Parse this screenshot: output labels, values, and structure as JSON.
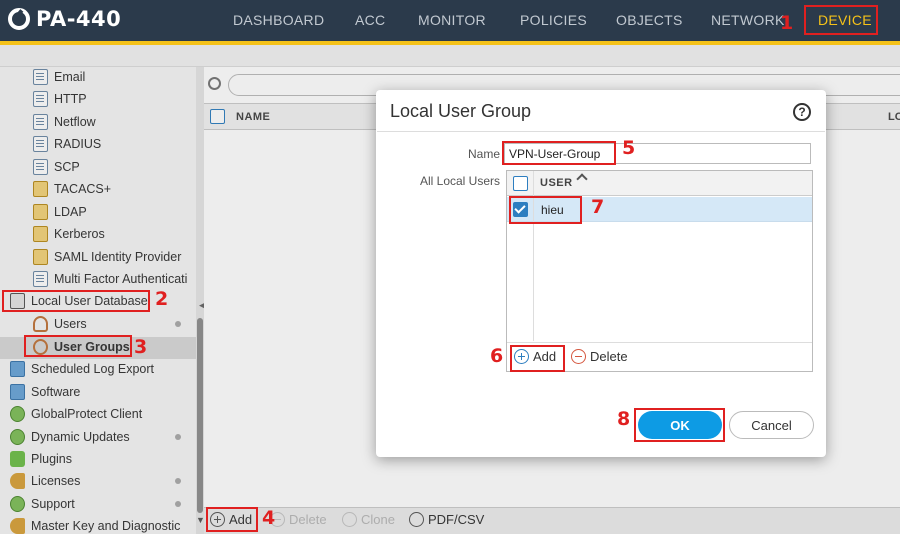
{
  "app": {
    "logo": "PA-440"
  },
  "nav": [
    {
      "label": "DASHBOARD"
    },
    {
      "label": "ACC"
    },
    {
      "label": "MONITOR"
    },
    {
      "label": "POLICIES"
    },
    {
      "label": "OBJECTS"
    },
    {
      "label": "NETWORK"
    },
    {
      "label": "DEVICE"
    }
  ],
  "sidebar": {
    "items": [
      {
        "label": "Email",
        "icon": "document-icon"
      },
      {
        "label": "HTTP",
        "icon": "document-icon"
      },
      {
        "label": "Netflow",
        "icon": "document-icon"
      },
      {
        "label": "RADIUS",
        "icon": "document-icon"
      },
      {
        "label": "SCP",
        "icon": "document-icon"
      },
      {
        "label": "TACACS+",
        "icon": "lock-icon"
      },
      {
        "label": "LDAP",
        "icon": "lock-icon"
      },
      {
        "label": "Kerberos",
        "icon": "lock-icon"
      },
      {
        "label": "SAML Identity Provider",
        "icon": "lock-icon"
      },
      {
        "label": "Multi Factor Authenticati",
        "icon": "document-icon"
      },
      {
        "label": "Local User Database",
        "icon": "database-icon"
      },
      {
        "label": "Users",
        "icon": "user-icon"
      },
      {
        "label": "User Groups",
        "icon": "users-icon"
      },
      {
        "label": "Scheduled Log Export",
        "icon": "export-icon"
      },
      {
        "label": "Software",
        "icon": "software-icon"
      },
      {
        "label": "GlobalProtect Client",
        "icon": "globe-icon"
      },
      {
        "label": "Dynamic Updates",
        "icon": "update-icon"
      },
      {
        "label": "Plugins",
        "icon": "puzzle-icon"
      },
      {
        "label": "Licenses",
        "icon": "key-icon"
      },
      {
        "label": "Support",
        "icon": "support-icon"
      },
      {
        "label": "Master Key and Diagnostic",
        "icon": "key-icon"
      }
    ]
  },
  "grid": {
    "columns": [
      "NAME",
      "LO"
    ]
  },
  "toolbar": {
    "add": "Add",
    "delete": "Delete",
    "clone": "Clone",
    "pdf_csv": "PDF/CSV"
  },
  "dialog": {
    "title": "Local User Group",
    "help": "?",
    "name_label": "Name",
    "name_value": "VPN-User-Group",
    "all_users_label": "All Local Users",
    "users_column": "USER",
    "users": [
      "hieu"
    ],
    "add": "Add",
    "delete": "Delete",
    "ok": "OK",
    "cancel": "Cancel"
  },
  "annotations": [
    "1",
    "2",
    "3",
    "4",
    "5",
    "6",
    "7",
    "8"
  ],
  "colors": {
    "header_bg": "#2b3a4b",
    "accent": "#f5c219",
    "primary": "#0d9be4",
    "annotation": "#e02020"
  }
}
